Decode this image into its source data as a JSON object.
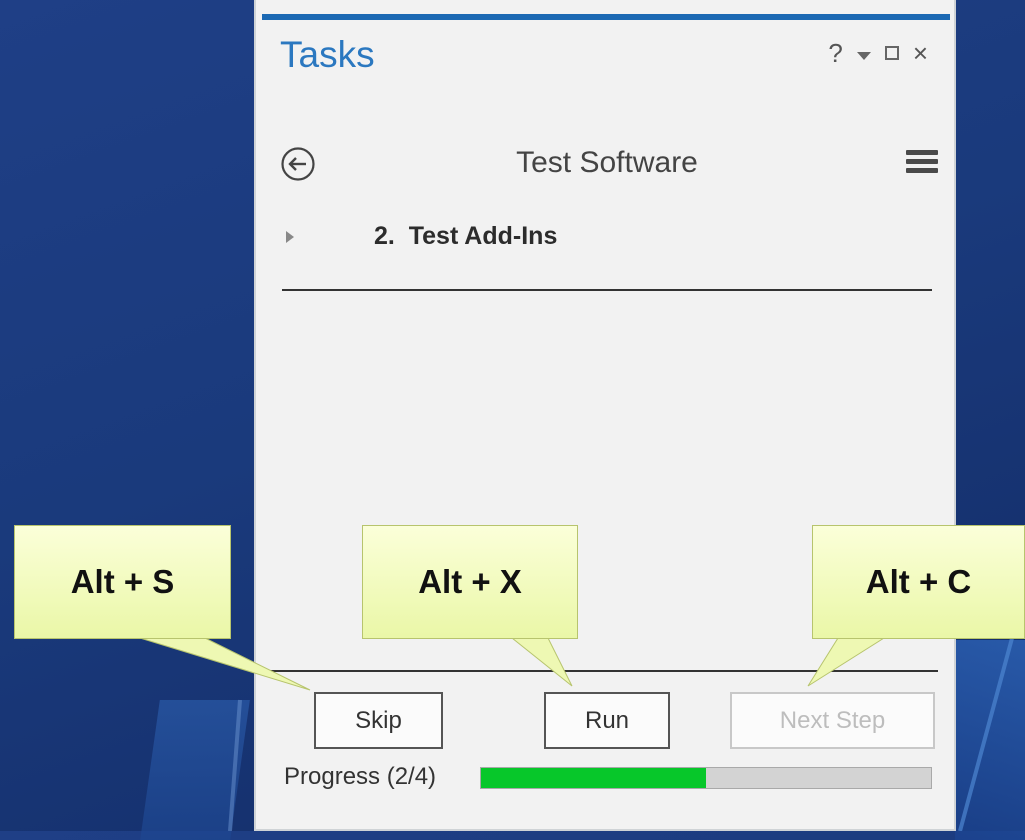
{
  "background": {
    "colors": {
      "bg_top": "#1f3f86",
      "bg_bottom": "#12295f"
    }
  },
  "pane": {
    "title": "Tasks",
    "controls": {
      "help": "?",
      "close": "×",
      "icons": [
        "question-icon",
        "dropdown-icon",
        "maximize-icon",
        "close-icon"
      ]
    },
    "task_title": "Test Software",
    "step": {
      "label": "2.  Test Add-Ins"
    },
    "buttons": {
      "skip": "Skip",
      "run": "Run",
      "next_step": "Next Step"
    },
    "progress": {
      "label": "Progress (2/4)",
      "current": 2,
      "total": 4,
      "fraction": 0.5
    },
    "colors": {
      "accent": "#1c69b3",
      "title": "#2b78c0",
      "progress_fill": "#07c72a"
    }
  },
  "callouts": [
    {
      "id": "skip",
      "text": "Alt + S"
    },
    {
      "id": "run",
      "text": "Alt + X"
    },
    {
      "id": "next_step",
      "text": "Alt + C"
    }
  ],
  "callout_colors": {
    "fill_top": "#fbffd9",
    "fill_bottom": "#eaf7a7",
    "border": "#b7c46d"
  }
}
